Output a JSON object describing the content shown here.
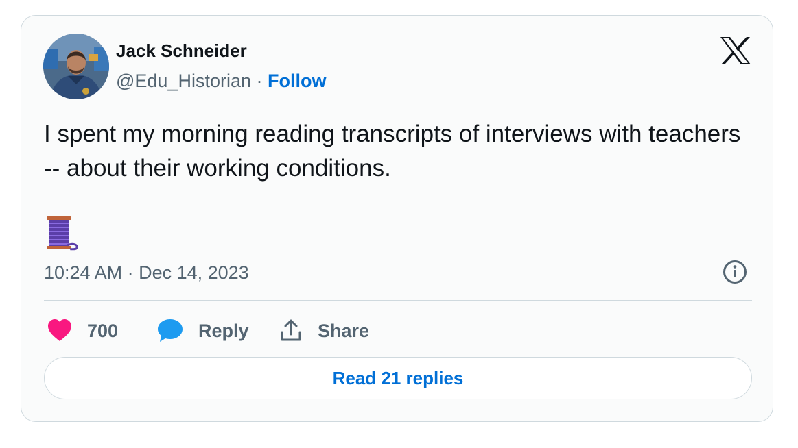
{
  "author": {
    "name": "Jack Schneider",
    "handle": "@Edu_Historian",
    "separator": "·",
    "follow_label": "Follow"
  },
  "tweet": {
    "text": "I spent my morning reading transcripts of interviews with teachers -- about their working conditions.",
    "emoji_icon": "thread-spool-icon",
    "timestamp": "10:24 AM · Dec 14, 2023"
  },
  "actions": {
    "likes_count": "700",
    "reply_label": "Reply",
    "share_label": "Share"
  },
  "read_replies_label": "Read 21 replies",
  "colors": {
    "like": "#f91880",
    "reply": "#1d9bf0",
    "link": "#006fd6",
    "muted": "#536471",
    "border": "#cfd9de"
  }
}
